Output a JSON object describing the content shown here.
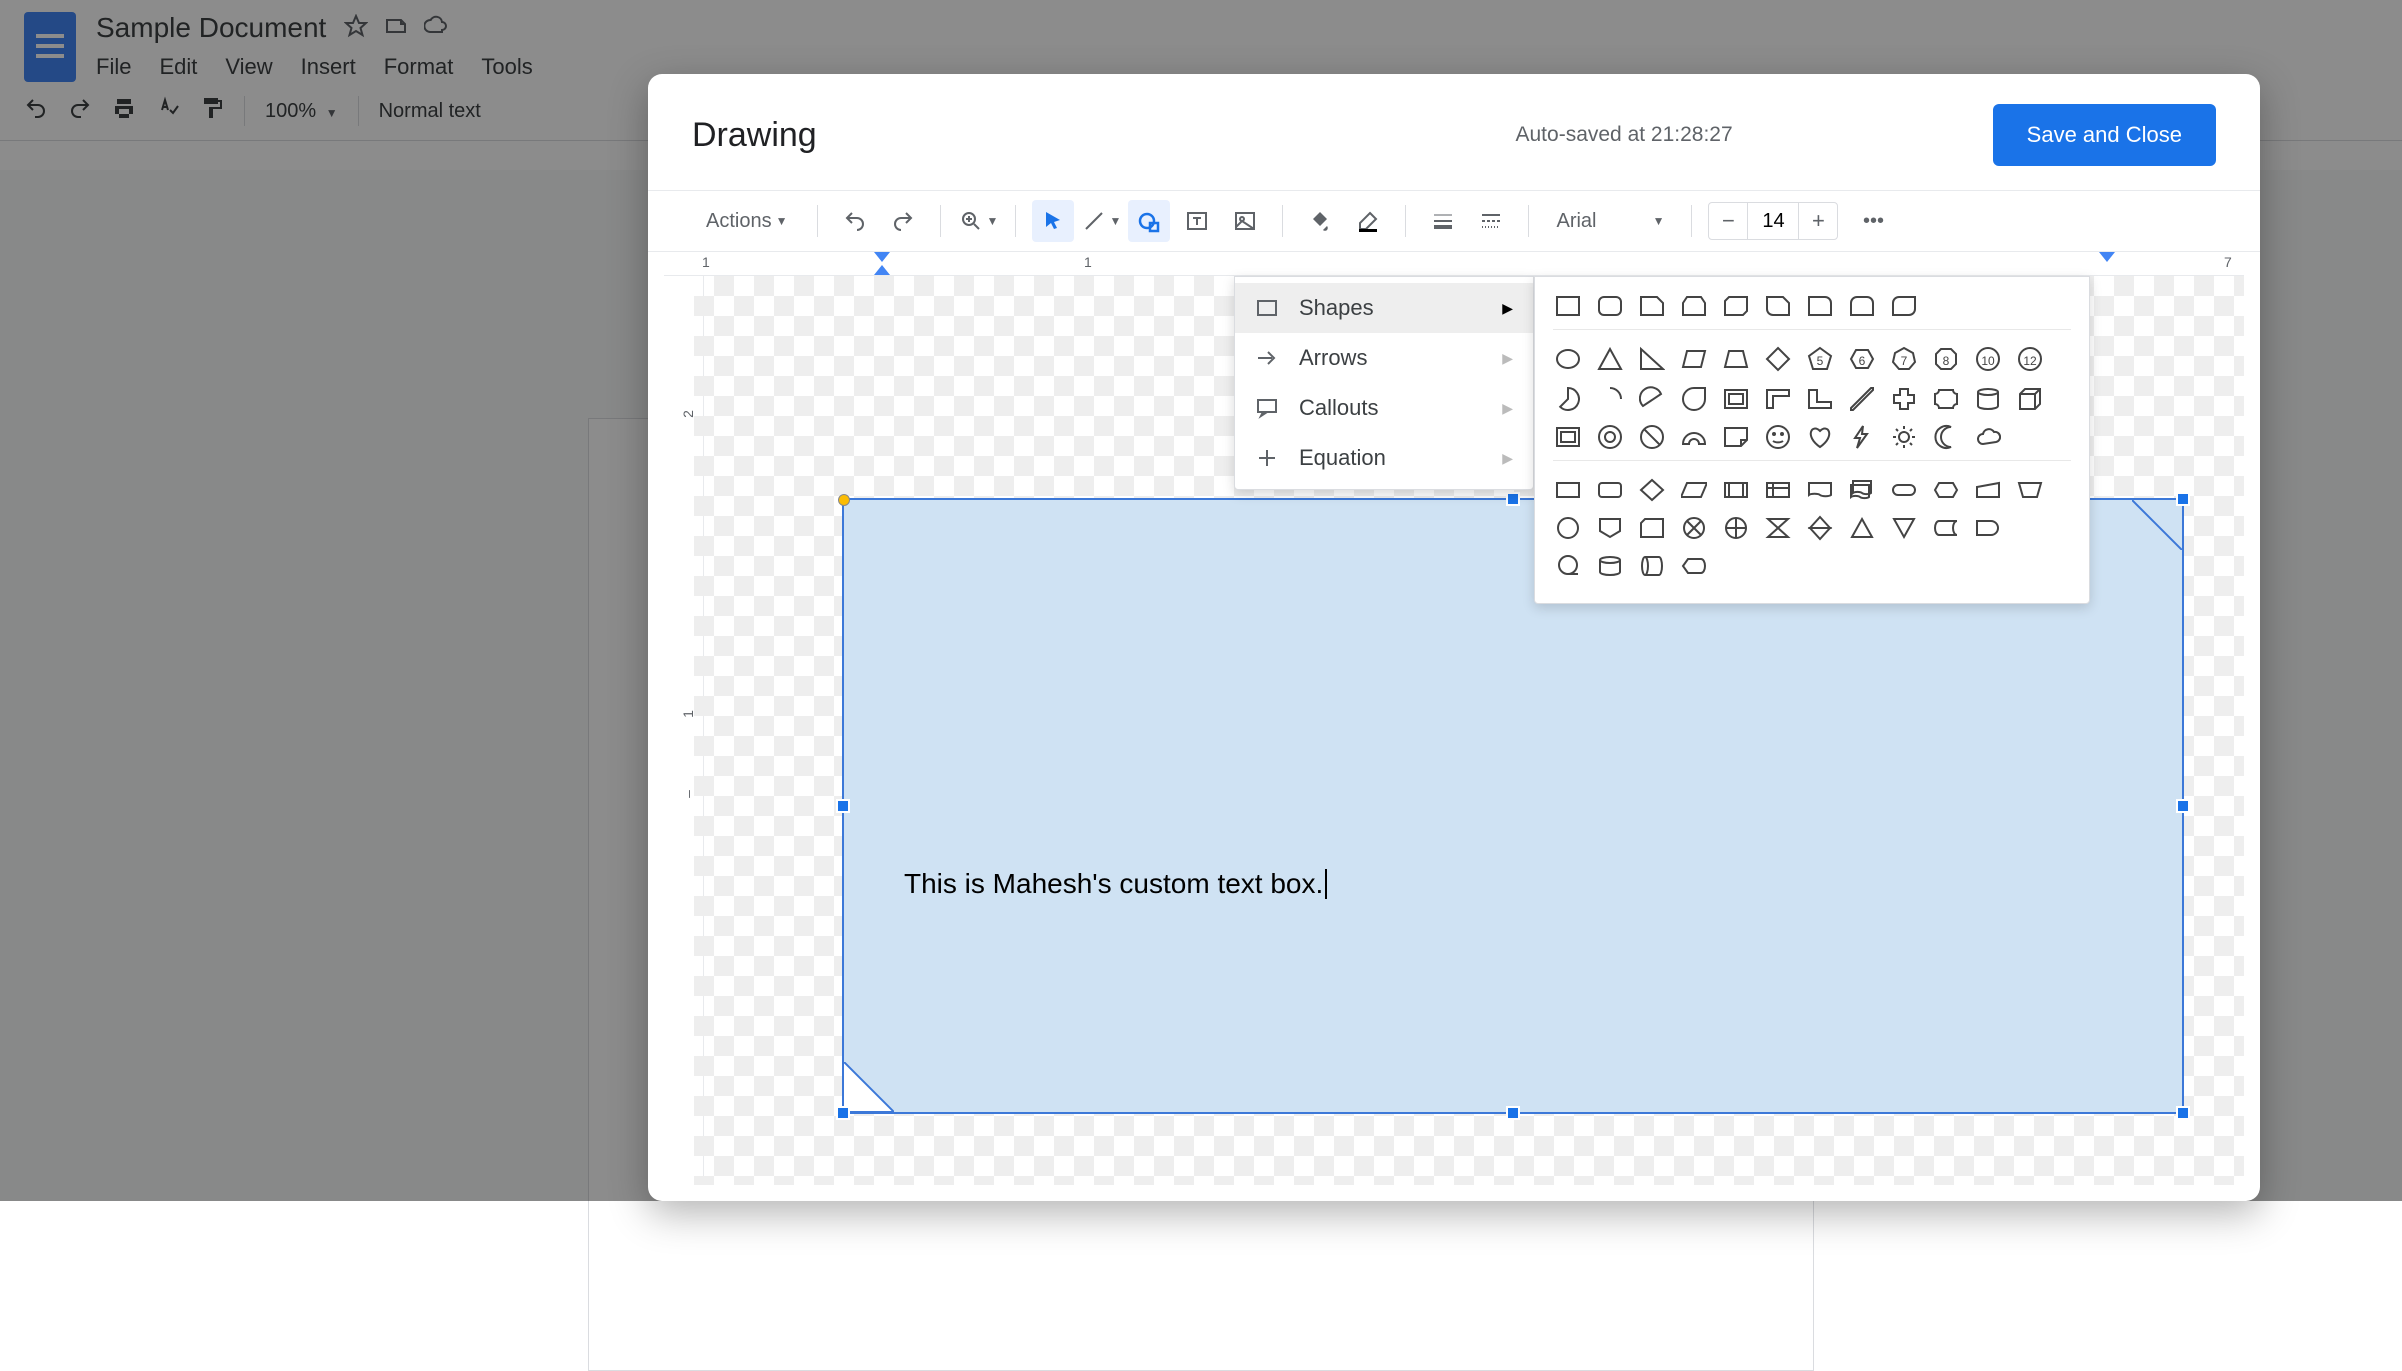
{
  "docs": {
    "title": "Sample Document",
    "menu": [
      "File",
      "Edit",
      "View",
      "Insert",
      "Format",
      "Tools"
    ],
    "zoom": "100%",
    "style": "Normal text"
  },
  "modal": {
    "title": "Drawing",
    "status": "Auto-saved at 21:28:27",
    "save_button": "Save and Close",
    "actions_label": "Actions",
    "font": "Arial",
    "font_size": "14",
    "textbox_content": "This is Mahesh's custom text box.",
    "ruler_h": [
      "1",
      "1",
      "7"
    ],
    "ruler_v": [
      "2",
      "1"
    ]
  },
  "shape_menu": {
    "items": [
      {
        "label": "Shapes",
        "icon": "rect"
      },
      {
        "label": "Arrows",
        "icon": "arrow"
      },
      {
        "label": "Callouts",
        "icon": "callout"
      },
      {
        "label": "Equation",
        "icon": "plus"
      }
    ]
  },
  "shapes_panel": {
    "polygon_labels": [
      "5",
      "6",
      "7",
      "8",
      "10",
      "12"
    ]
  }
}
